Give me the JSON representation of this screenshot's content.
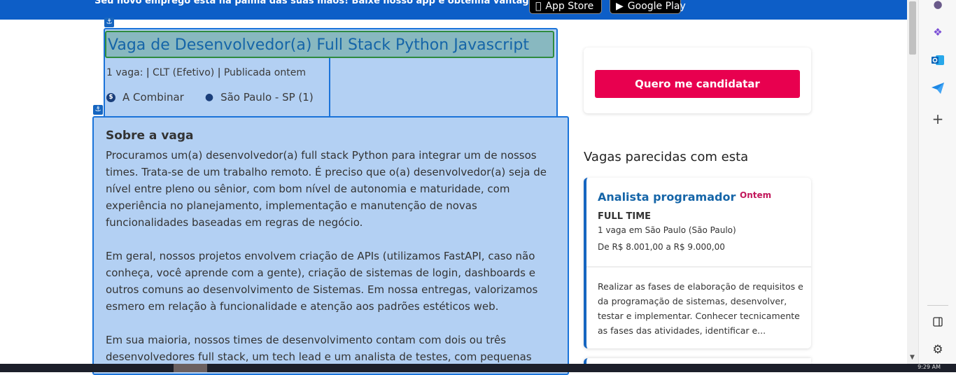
{
  "banner": {
    "text": "Seu novo emprego está na palma das suas mãos! Baixe nosso app e obtenha vantagens :)",
    "app_store": "App Store",
    "google_play": "Google Play"
  },
  "job": {
    "title": "Vaga de Desenvolvedor(a) Full Stack Python Javascript",
    "count": "1 vaga:",
    "contract": "CLT (Efetivo)",
    "published": "Publicada ontem",
    "salary": "A Combinar",
    "location": "São Paulo - SP (1)"
  },
  "description": {
    "heading": "Sobre a vaga",
    "paragraphs": [
      "Procuramos um(a) desenvolvedor(a) full stack Python para integrar um de nossos times. Trata-se de um trabalho remoto. É preciso que o(a) desenvolvedor(a) seja de nível entre pleno ou sênior, com bom nível de autonomia e maturidade, com experiência no planejamento, implementação e manutenção de novas funcionalidades baseadas em regras de negócio.",
      "Em geral, nossos projetos envolvem criação de APIs (utilizamos FastAPI, caso não conheça, você aprende com a gente), criação de sistemas de login, dashboards e outros comuns ao desenvolvimento de Sistemas. Em nossa entregas, valorizamos esmero em relação à funcionalidade e atenção aos padrões estéticos web.",
      "Em sua maioria, nossos times de desenvolvimento contam com dois ou três desenvolvedores full stack, um tech lead e um analista de testes, com pequenas"
    ]
  },
  "apply": {
    "label": "Quero me candidatar"
  },
  "similar": {
    "heading": "Vagas parecidas com esta",
    "cards": [
      {
        "title": "Analista programador",
        "date": "Ontem",
        "type": "FULL TIME",
        "location": "1 vaga em São Paulo (São Paulo)",
        "salary": "De R$ 8.001,00 a R$ 9.000,00",
        "description": "Realizar as fases de elaboração de requisitos e da programação de sistemas, desenvolver, testar e implementar. Conhecer tecnicamente as fases das atividades, identificar e..."
      }
    ]
  },
  "edge_sidebar": {
    "icons": [
      "profile-icon",
      "copilot-icon",
      "outlook-icon",
      "telegram-icon",
      "add-icon",
      "sidebar-toggle-icon",
      "settings-icon"
    ]
  },
  "taskbar": {
    "time": "9:29 AM"
  },
  "colors": {
    "banner": "#0d5ec7",
    "apply_button": "#e8004f",
    "highlight": "#b3d0f3",
    "link": "#1565a8"
  }
}
